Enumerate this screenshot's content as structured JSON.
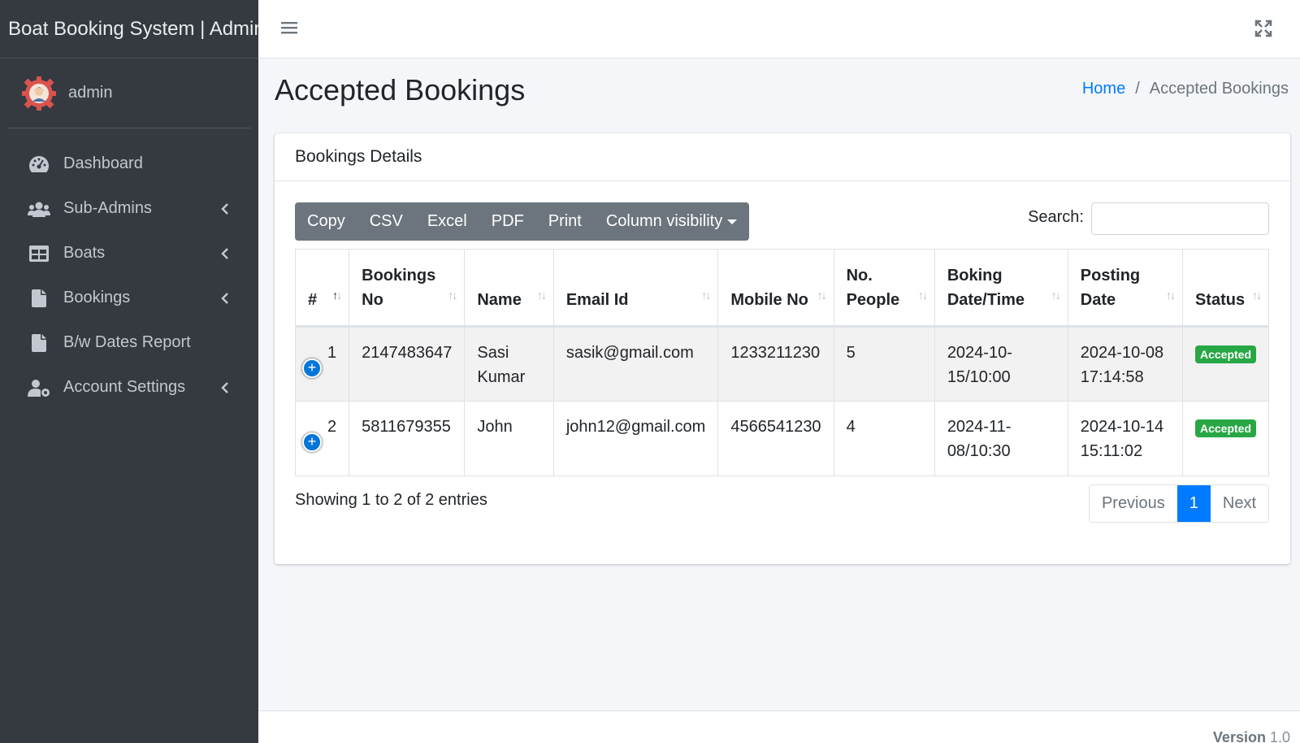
{
  "brand": {
    "title": "Boat Booking System | Admin"
  },
  "user": {
    "name": "admin"
  },
  "sidebar": {
    "items": [
      {
        "label": "Dashboard",
        "icon": "dashboard-gauge-icon",
        "has_submenu": false
      },
      {
        "label": "Sub-Admins",
        "icon": "users-icon",
        "has_submenu": true
      },
      {
        "label": "Boats",
        "icon": "table-grid-icon",
        "has_submenu": true
      },
      {
        "label": "Bookings",
        "icon": "file-icon",
        "has_submenu": true
      },
      {
        "label": "B/w Dates Report",
        "icon": "file-icon",
        "has_submenu": false
      },
      {
        "label": "Account Settings",
        "icon": "user-cog-icon",
        "has_submenu": true
      }
    ]
  },
  "page": {
    "title": "Accepted Bookings",
    "breadcrumb": {
      "home": "Home",
      "sep": "/",
      "current": "Accepted Bookings"
    }
  },
  "card": {
    "title": "Bookings Details",
    "buttons": [
      "Copy",
      "CSV",
      "Excel",
      "PDF",
      "Print",
      "Column visibility"
    ],
    "search_label": "Search:",
    "search_value": ""
  },
  "table": {
    "headers": [
      "#",
      "Bookings No",
      "Name",
      "Email Id",
      "Mobile No",
      "No. People",
      "Boking Date/Time",
      "Posting Date",
      "Status"
    ],
    "rows": [
      {
        "idx": "1",
        "booking_no": "2147483647",
        "name": "Sasi Kumar",
        "email": "sasik@gmail.com",
        "mobile": "1233211230",
        "people": "5",
        "boking": "2024-10-15/10:00",
        "posting": "2024-10-08 17:14:58",
        "status": "Accepted"
      },
      {
        "idx": "2",
        "booking_no": "5811679355",
        "name": "John",
        "email": "john12@gmail.com",
        "mobile": "4566541230",
        "people": "4",
        "boking": "2024-11-08/10:30",
        "posting": "2024-10-14 15:11:02",
        "status": "Accepted"
      }
    ]
  },
  "table_info": "Showing 1 to 2 of 2 entries",
  "pagination": {
    "previous": "Previous",
    "current": "1",
    "next": "Next"
  },
  "footer": {
    "version_label": "Version",
    "version_value": "1.0"
  },
  "colors": {
    "sidebar": "#343a40",
    "primary": "#007bff",
    "success": "#28a745",
    "btn_secondary": "#6c757d"
  }
}
